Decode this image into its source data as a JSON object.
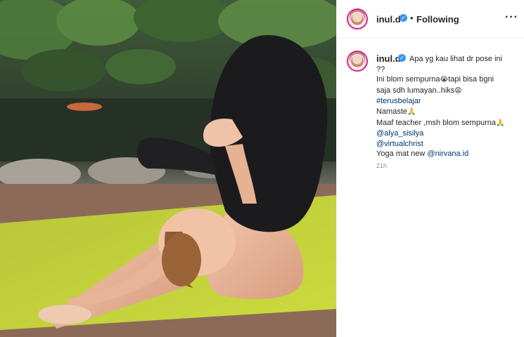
{
  "post": {
    "username": "inul.d",
    "verified_mark": "✓",
    "separator": "•",
    "follow_status": "Following",
    "more_icon": "···",
    "caption": {
      "line1": "Apa yg kau lihat dr pose ini",
      "line2": "??",
      "line3a": "Ini blom sempurna",
      "emoji1": "😭",
      "line3b": "tapi bisa bgni",
      "line4": "saja sdh lumayan..hiks",
      "emoji2": "😩",
      "hashtag": "#terusbelajar",
      "line6": "Namaste",
      "emoji3": "🙏",
      "line7": "Maaf teacher ,msh blom sempurna",
      "emoji4": "🙏",
      "mention1": "@alya_sisilya",
      "mention2": "@virtualchrist",
      "line10a": "Yoga mat new ",
      "mention3": "@nirvana.id"
    },
    "timestamp": "21h"
  },
  "colors": {
    "verified": "#3897f0",
    "link": "#00376b",
    "mat": "#c3d13a",
    "outfit": "#1b1b1d"
  },
  "icons": [
    "avatar",
    "verified-badge-icon",
    "more-options-icon"
  ]
}
